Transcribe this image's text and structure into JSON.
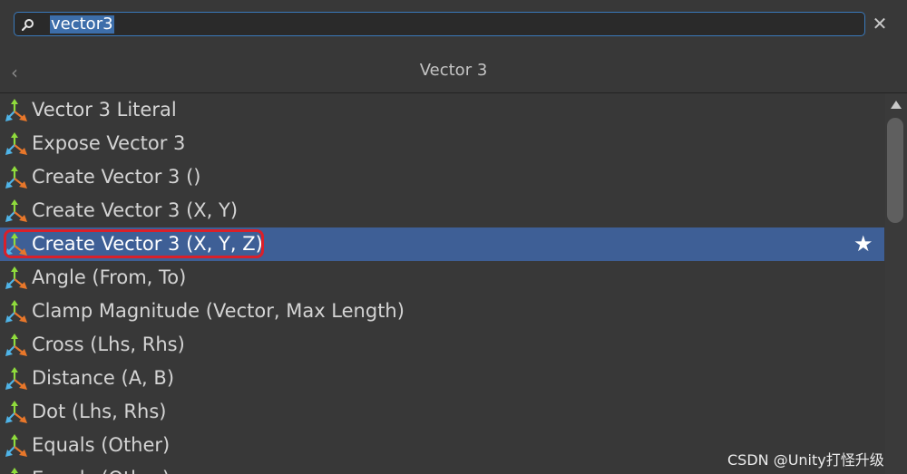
{
  "search": {
    "value": "vector3"
  },
  "header": {
    "title": "Vector 3"
  },
  "items": [
    {
      "label": "Vector 3 Literal"
    },
    {
      "label": "Expose Vector 3"
    },
    {
      "label": "Create Vector 3 ()"
    },
    {
      "label": "Create Vector 3 (X, Y)"
    },
    {
      "label": "Create Vector 3 (X, Y, Z)",
      "selected": true
    },
    {
      "label": "Angle (From, To)"
    },
    {
      "label": "Clamp Magnitude (Vector, Max Length)"
    },
    {
      "label": "Cross (Lhs, Rhs)"
    },
    {
      "label": "Distance (A, B)"
    },
    {
      "label": "Dot (Lhs, Rhs)"
    },
    {
      "label": "Equals (Other)"
    },
    {
      "label": "Equals (Other)"
    }
  ],
  "icons": {
    "search": "search-icon",
    "clear": "close-icon",
    "back": "chevron-left-icon",
    "item": "vector-axes-icon",
    "favorite": "star-icon"
  },
  "colors": {
    "background": "#383838",
    "selection": "#3e5f96",
    "highlight_border": "#d9202a",
    "search_border": "#3a79bb"
  },
  "watermark": "CSDN @Unity打怪升级"
}
